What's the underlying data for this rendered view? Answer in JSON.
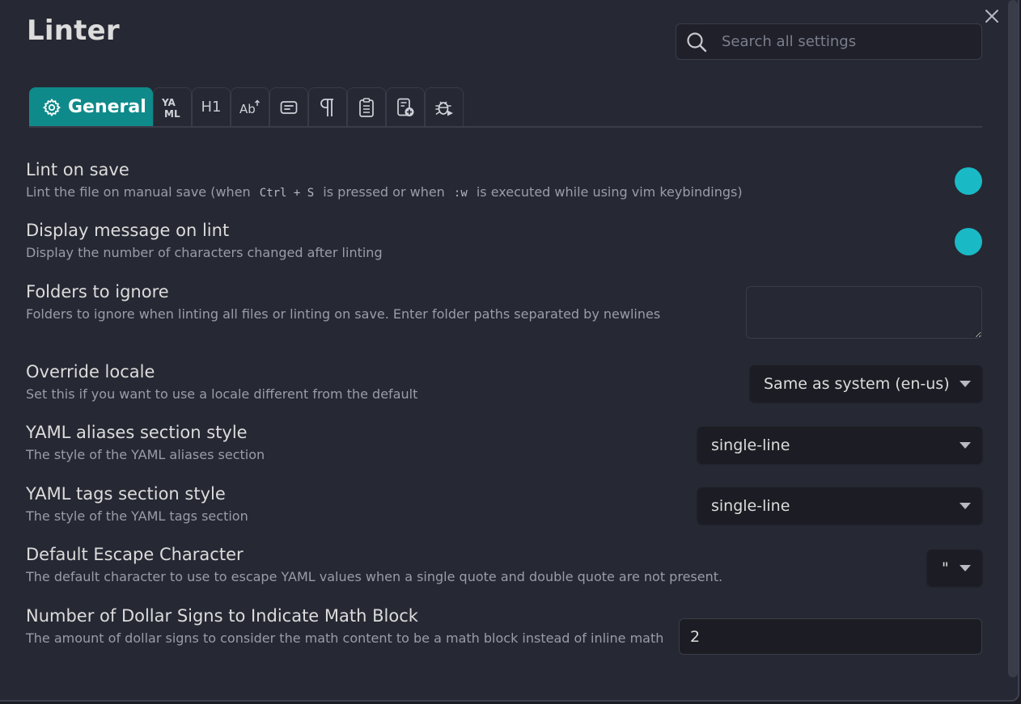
{
  "header": {
    "title": "Linter",
    "search_placeholder": "Search all settings"
  },
  "tabs": [
    {
      "label": "General",
      "icon": "gear-icon",
      "active": true
    },
    {
      "label": "YAML",
      "icon": "yaml-icon"
    },
    {
      "label": "H1",
      "icon": "heading-icon"
    },
    {
      "label": "Ab",
      "icon": "spelling-icon"
    },
    {
      "label": "",
      "icon": "content-icon"
    },
    {
      "label": "¶",
      "icon": "paragraph-icon"
    },
    {
      "label": "",
      "icon": "clipboard-icon"
    },
    {
      "label": "",
      "icon": "custom-file-add-icon"
    },
    {
      "label": "",
      "icon": "debug-icon"
    }
  ],
  "settings": {
    "lint_on_save": {
      "name": "Lint on save",
      "desc_pre": "Lint the file on manual save (when",
      "code1": "Ctrl + S",
      "desc_mid": "is pressed or when",
      "code2": ":w",
      "desc_post": "is executed while using vim keybindings)",
      "enabled": true
    },
    "display_message": {
      "name": "Display message on lint",
      "desc": "Display the number of characters changed after linting",
      "enabled": true
    },
    "folders_to_ignore": {
      "name": "Folders to ignore",
      "desc": "Folders to ignore when linting all files or linting on save. Enter folder paths separated by newlines",
      "value": ""
    },
    "override_locale": {
      "name": "Override locale",
      "desc": "Set this if you want to use a locale different from the default",
      "value": "Same as system (en-us)"
    },
    "yaml_aliases_style": {
      "name": "YAML aliases section style",
      "desc": "The style of the YAML aliases section",
      "value": "single-line"
    },
    "yaml_tags_style": {
      "name": "YAML tags section style",
      "desc": "The style of the YAML tags section",
      "value": "single-line"
    },
    "default_escape": {
      "name": "Default Escape Character",
      "desc": "The default character to use to escape YAML values when a single quote and double quote are not present.",
      "value": "\""
    },
    "math_block_dollars": {
      "name": "Number of Dollar Signs to Indicate Math Block",
      "desc": "The amount of dollar signs to consider the math content to be a math block instead of inline math",
      "value": "2"
    }
  },
  "colors": {
    "accent": "#0f8a8a",
    "toggle": "#1ab9c6",
    "background": "#262833"
  }
}
